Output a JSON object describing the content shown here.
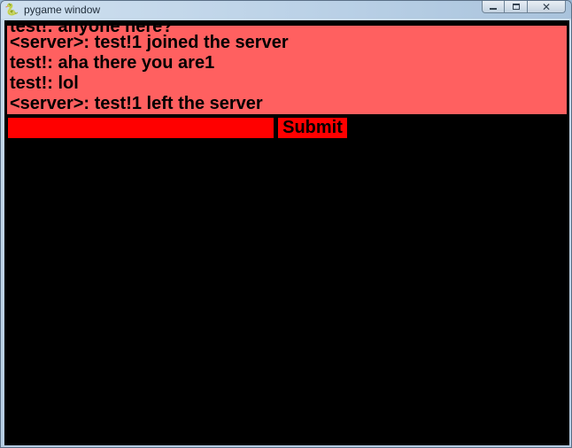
{
  "window": {
    "title": "pygame window",
    "icon": "pygame-snake-icon",
    "controls": {
      "minimize": "minimize-icon",
      "maximize": "maximize-icon",
      "close": "✕"
    }
  },
  "chat": {
    "background_color": "#ff6060",
    "messages": [
      "test!: anyone here?",
      "<server>: test!1 joined the server",
      "test!: aha there you are1",
      "test!: lol",
      "<server>: test!1 left the server"
    ]
  },
  "input": {
    "value": "",
    "placeholder": "",
    "color": "#ff0000"
  },
  "submit": {
    "label": "Submit",
    "color": "#ff0000"
  }
}
